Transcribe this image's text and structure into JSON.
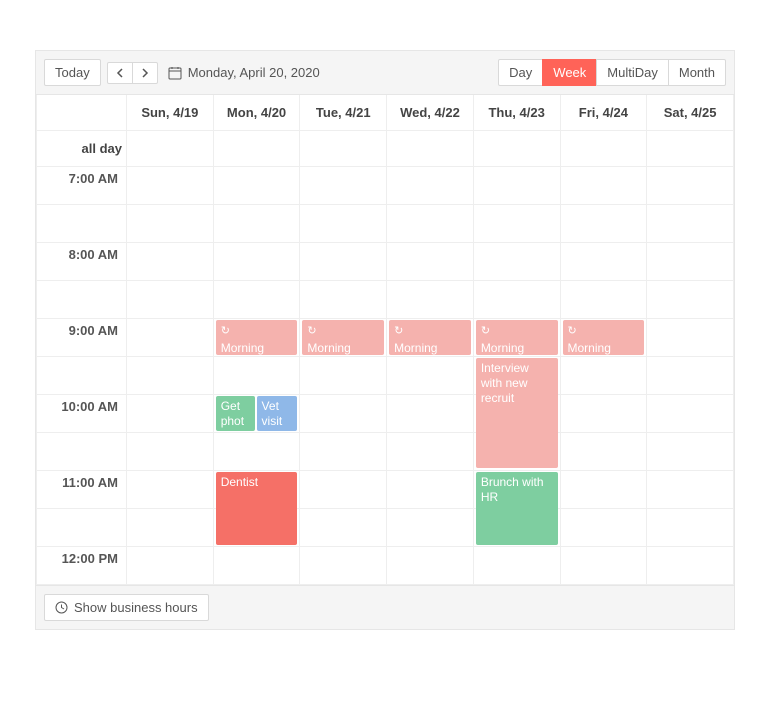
{
  "toolbar": {
    "today_label": "Today",
    "current_date": "Monday, April 20, 2020"
  },
  "views": {
    "day": "Day",
    "week": "Week",
    "multiday": "MultiDay",
    "month": "Month",
    "active": "week"
  },
  "columns": {
    "all_day": "all day",
    "days": [
      "Sun, 4/19",
      "Mon, 4/20",
      "Tue, 4/21",
      "Wed, 4/22",
      "Thu, 4/23",
      "Fri, 4/24",
      "Sat, 4/25"
    ]
  },
  "time_slots": [
    "7:00 AM",
    "8:00 AM",
    "9:00 AM",
    "10:00 AM",
    "11:00 AM",
    "12:00 PM"
  ],
  "events": {
    "morning": "Morning",
    "get_phot": "Get phot",
    "vet_visit": "Vet visit",
    "dentist": "Dentist",
    "interview": "Interview with new recruit",
    "brunch_hr": "Brunch with HR"
  },
  "footer": {
    "business_hours": "Show business hours"
  },
  "colors": {
    "accent": "#ff6358"
  }
}
